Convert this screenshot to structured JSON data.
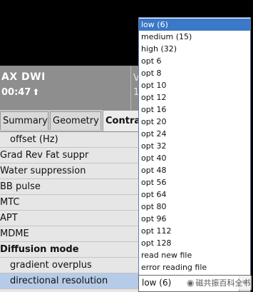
{
  "header": {
    "scan_name": "AX DWI",
    "scan_time": "00:47",
    "time_icon": "up-arrow-icon",
    "right_label_1": "V",
    "right_label_2": "1"
  },
  "tabs": [
    {
      "label": "Summary"
    },
    {
      "label": "Geometry"
    },
    {
      "label": "Contra"
    }
  ],
  "parameters": [
    {
      "label": "offset (Hz)",
      "indent": true,
      "bold": false
    },
    {
      "label": "Grad Rev Fat suppr",
      "indent": false,
      "bold": false
    },
    {
      "label": "Water suppression",
      "indent": false,
      "bold": false
    },
    {
      "label": "BB pulse",
      "indent": false,
      "bold": false
    },
    {
      "label": "MTC",
      "indent": false,
      "bold": false
    },
    {
      "label": "APT",
      "indent": false,
      "bold": false
    },
    {
      "label": "MDME",
      "indent": false,
      "bold": false
    },
    {
      "label": "Diffusion mode",
      "indent": false,
      "bold": true
    },
    {
      "label": "gradient overplus",
      "indent": true,
      "bold": false
    },
    {
      "label": "directional resolution",
      "indent": true,
      "bold": false,
      "selected": true
    }
  ],
  "dropdown": {
    "selected_value": "low (6)",
    "highlighted_index": 0,
    "options": [
      "low (6)",
      "medium (15)",
      "high (32)",
      "opt 6",
      "opt 8",
      "opt 10",
      "opt 12",
      "opt 16",
      "opt 20",
      "opt 24",
      "opt 32",
      "opt 40",
      "opt 48",
      "opt 56",
      "opt 64",
      "opt 80",
      "opt 96",
      "opt 112",
      "opt 128",
      "read new file",
      "error reading file"
    ]
  },
  "watermark": {
    "icon": "wechat-icon",
    "text": "磁共振百科全书"
  },
  "colors": {
    "highlight": "#3a78c8",
    "selected_row": "#b5cbe8",
    "header_gray": "#8e8e8e"
  }
}
